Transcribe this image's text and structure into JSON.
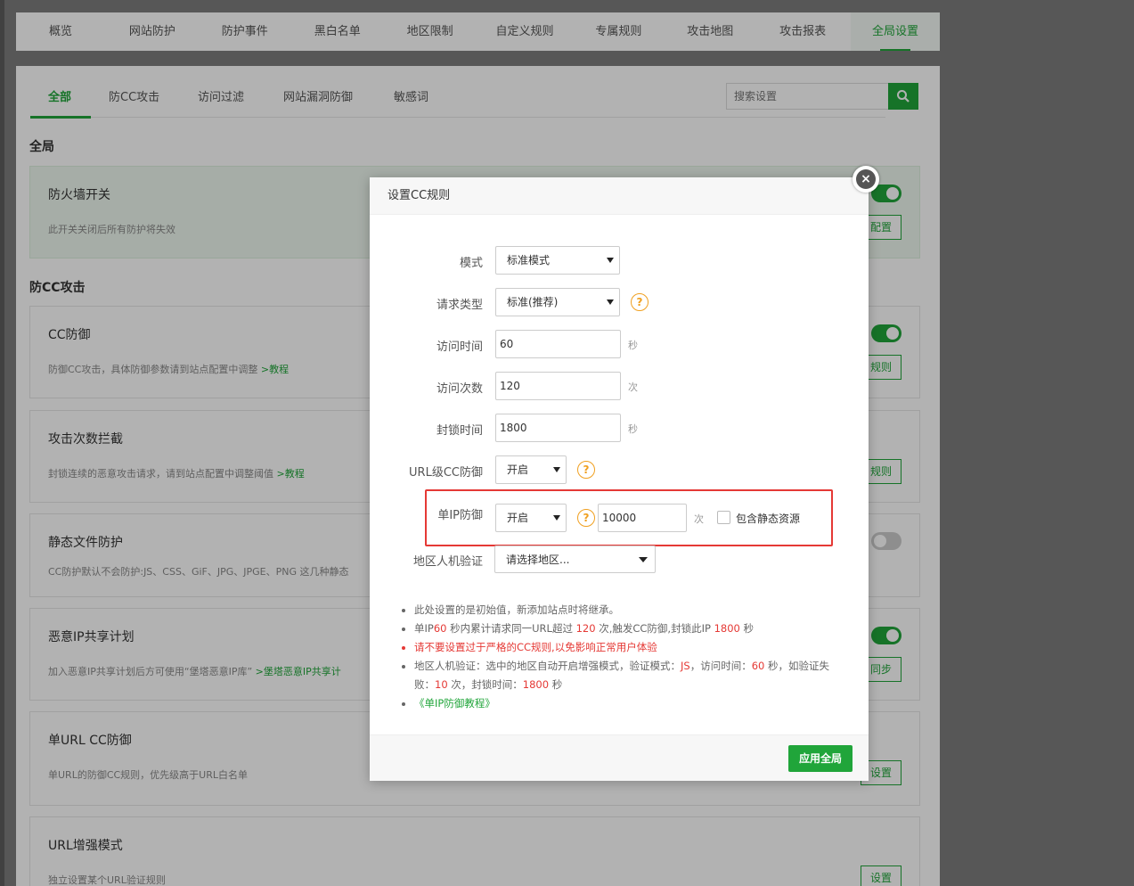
{
  "topnav": {
    "tabs": [
      "概览",
      "网站防护",
      "防护事件",
      "黑白名单",
      "地区限制",
      "自定义规则",
      "专属规则",
      "攻击地图",
      "攻击报表",
      "全局设置"
    ],
    "active_index": 9
  },
  "subtabs": {
    "items": [
      "全部",
      "防CC攻击",
      "访问过滤",
      "网站漏洞防御",
      "敏感词"
    ],
    "active_index": 0
  },
  "search": {
    "placeholder": "搜索设置"
  },
  "sections": {
    "global": "全局",
    "cc": "防CC攻击"
  },
  "cards": [
    {
      "title": "防火墙开关",
      "desc": "此开关关闭后所有防护将失效",
      "button": "配置",
      "toggle": "on"
    },
    {
      "title": "CC防御",
      "desc": "防御CC攻击，具体防御参数请到站点配置中调整",
      "link": ">教程",
      "button": "规则",
      "toggle": "on"
    },
    {
      "title": "攻击次数拦截",
      "desc": "封锁连续的恶意攻击请求，请到站点配置中调整阈值",
      "link": ">教程",
      "button": "规则",
      "toggle": ""
    },
    {
      "title": "静态文件防护",
      "desc": "CC防护默认不会防护:JS、CSS、GiF、JPG、JPGE、PNG 这几种静态",
      "toggle": "off"
    },
    {
      "title": "恶意IP共享计划",
      "desc": "加入恶意IP共享计划后方可使用“堡塔恶意IP库”",
      "link": ">堡塔恶意IP共享计",
      "button": "同步",
      "toggle": "on"
    },
    {
      "title": "单URL CC防御",
      "desc": "单URL的防御CC规则，优先级高于URL白名单",
      "button": "设置",
      "toggle": ""
    },
    {
      "title": "URL增强模式",
      "desc": "独立设置某个URL验证规则",
      "button": "设置",
      "toggle": ""
    }
  ],
  "modal": {
    "title": "设置CC规则",
    "close": "×",
    "fields": {
      "mode": {
        "label": "模式",
        "value": "标准模式"
      },
      "req_type": {
        "label": "请求类型",
        "value": "标准(推荐)"
      },
      "visit_time": {
        "label": "访问时间",
        "value": "60",
        "unit": "秒"
      },
      "visit_count": {
        "label": "访问次数",
        "value": "120",
        "unit": "次"
      },
      "block_time": {
        "label": "封锁时间",
        "value": "1800",
        "unit": "秒"
      },
      "url_cc": {
        "label": "URL级CC防御",
        "value": "开启"
      },
      "single_ip": {
        "label": "单IP防御",
        "value": "开启",
        "count": "10000",
        "unit": "次",
        "checkbox_label": "包含静态资源"
      },
      "region": {
        "label": "地区人机验证",
        "placeholder": "请选择地区..."
      }
    },
    "help_icon": "?",
    "notes": {
      "n1": "此处设置的是初始值，新添加站点时将继承。",
      "n2": {
        "a": "单IP",
        "v1": "60",
        "b": " 秒内累计请求同一URL超过 ",
        "v2": "120",
        "c": " 次,触发CC防御,封锁此IP ",
        "v3": "1800",
        "d": " 秒"
      },
      "n3": "请不要设置过于严格的CC规则,以免影响正常用户体验",
      "n4": {
        "a": "地区人机验证：选中的地区自动开启增强模式，验证模式：",
        "v1": "JS",
        "b": "，访问时间：",
        "v2": "60",
        "c": " 秒，如验证失败：",
        "v3": "10",
        "d": " 次，封锁时间：",
        "v4": "1800",
        "e": " 秒"
      },
      "n5": "《单IP防御教程》"
    },
    "apply_button": "应用全局"
  },
  "colors": {
    "accent": "#20a53a",
    "danger": "#e53935",
    "warning": "#f0a020"
  }
}
